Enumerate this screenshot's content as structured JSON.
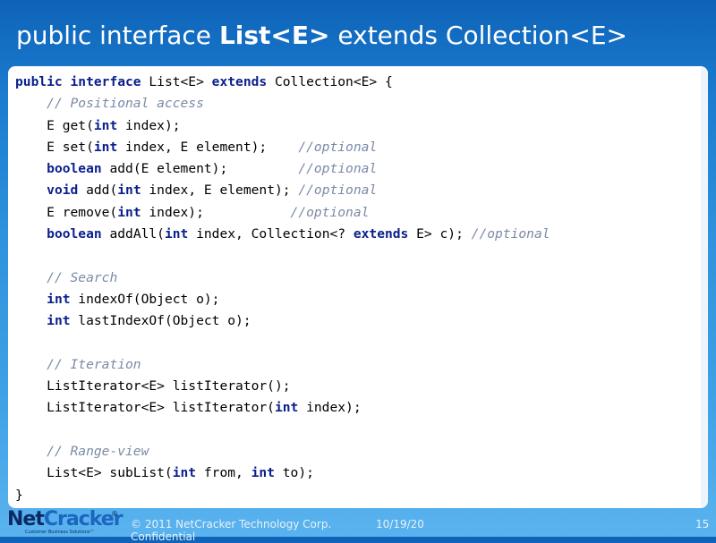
{
  "slide": {
    "title_prefix": "public interface ",
    "title_bold": "List<E>",
    "title_suffix": " extends Collection<E>"
  },
  "code": {
    "lines": [
      [
        {
          "t": "public",
          "k": "kw"
        },
        {
          "t": " "
        },
        {
          "t": "interface",
          "k": "kw"
        },
        {
          "t": " List<E> "
        },
        {
          "t": "extends",
          "k": "kw"
        },
        {
          "t": " Collection<E> {"
        }
      ],
      [
        {
          "t": "    "
        },
        {
          "t": "// Positional access",
          "k": "cm"
        }
      ],
      [
        {
          "t": "    E get("
        },
        {
          "t": "int",
          "k": "kw"
        },
        {
          "t": " index);"
        }
      ],
      [
        {
          "t": "    E set("
        },
        {
          "t": "int",
          "k": "kw"
        },
        {
          "t": " index, E element);    "
        },
        {
          "t": "//optional",
          "k": "cm"
        }
      ],
      [
        {
          "t": "    "
        },
        {
          "t": "boolean",
          "k": "kw"
        },
        {
          "t": " add(E element);         "
        },
        {
          "t": "//optional",
          "k": "cm"
        }
      ],
      [
        {
          "t": "    "
        },
        {
          "t": "void",
          "k": "kw"
        },
        {
          "t": " add("
        },
        {
          "t": "int",
          "k": "kw"
        },
        {
          "t": " index, E element); "
        },
        {
          "t": "//optional",
          "k": "cm"
        }
      ],
      [
        {
          "t": "    E remove("
        },
        {
          "t": "int",
          "k": "kw"
        },
        {
          "t": " index);           "
        },
        {
          "t": "//optional",
          "k": "cm"
        }
      ],
      [
        {
          "t": "    "
        },
        {
          "t": "boolean",
          "k": "kw"
        },
        {
          "t": " addAll("
        },
        {
          "t": "int",
          "k": "kw"
        },
        {
          "t": " index, Collection<? "
        },
        {
          "t": "extends",
          "k": "kw"
        },
        {
          "t": " E> c); "
        },
        {
          "t": "//optional",
          "k": "cm"
        }
      ],
      [
        {
          "t": ""
        }
      ],
      [
        {
          "t": "    "
        },
        {
          "t": "// Search",
          "k": "cm"
        }
      ],
      [
        {
          "t": "    "
        },
        {
          "t": "int",
          "k": "kw"
        },
        {
          "t": " indexOf(Object o);"
        }
      ],
      [
        {
          "t": "    "
        },
        {
          "t": "int",
          "k": "kw"
        },
        {
          "t": " lastIndexOf(Object o);"
        }
      ],
      [
        {
          "t": ""
        }
      ],
      [
        {
          "t": "    "
        },
        {
          "t": "// Iteration",
          "k": "cm"
        }
      ],
      [
        {
          "t": "    ListIterator<E> listIterator();"
        }
      ],
      [
        {
          "t": "    ListIterator<E> listIterator("
        },
        {
          "t": "int",
          "k": "kw"
        },
        {
          "t": " index);"
        }
      ],
      [
        {
          "t": ""
        }
      ],
      [
        {
          "t": "    "
        },
        {
          "t": "// Range-view",
          "k": "cm"
        }
      ],
      [
        {
          "t": "    List<E> subList("
        },
        {
          "t": "int",
          "k": "kw"
        },
        {
          "t": " from, "
        },
        {
          "t": "int",
          "k": "kw"
        },
        {
          "t": " to);"
        }
      ],
      [
        {
          "t": "}"
        }
      ]
    ]
  },
  "footer": {
    "logo_part1": "Net",
    "logo_part2": "Cracker",
    "logo_reg": "®",
    "logo_tagline": "Customer Business Solutions™",
    "copyright": "© 2011 NetCracker Technology Corp.",
    "confidential": "Confidential",
    "date": "10/19/20",
    "page_number": "15"
  },
  "colors": {
    "keyword": "#0b1f8c",
    "comment": "#7a8aa6",
    "background_top": "#0e63b8",
    "background_bottom": "#5ab3ee"
  }
}
